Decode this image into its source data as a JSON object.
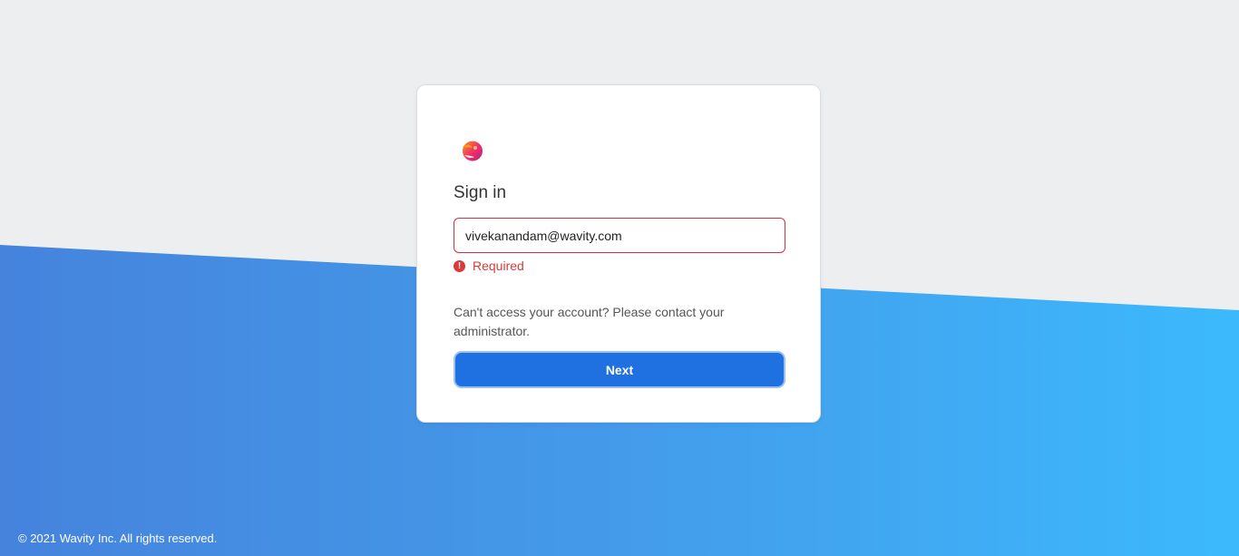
{
  "brand": {
    "logo_icon": "wavity-logo-icon",
    "logo_colors": [
      "#f7931e",
      "#ec2f6b",
      "#b4237a"
    ]
  },
  "signin": {
    "title": "Sign in",
    "email_value": "vivekanandam@wavity.com",
    "email_placeholder": "",
    "error_icon": "error-circle-icon",
    "error_symbol": "!",
    "error_text": "Required",
    "help_text": "Can't access your account? Please contact your administrator.",
    "next_label": "Next"
  },
  "footer": {
    "copyright": "© 2021 Wavity Inc. All rights reserved."
  },
  "colors": {
    "background_top": "#edeef0",
    "gradient_start": "#4583dd",
    "gradient_end": "#3cb9fd",
    "error": "#d93a3a",
    "primary_button": "#1f70e1"
  }
}
